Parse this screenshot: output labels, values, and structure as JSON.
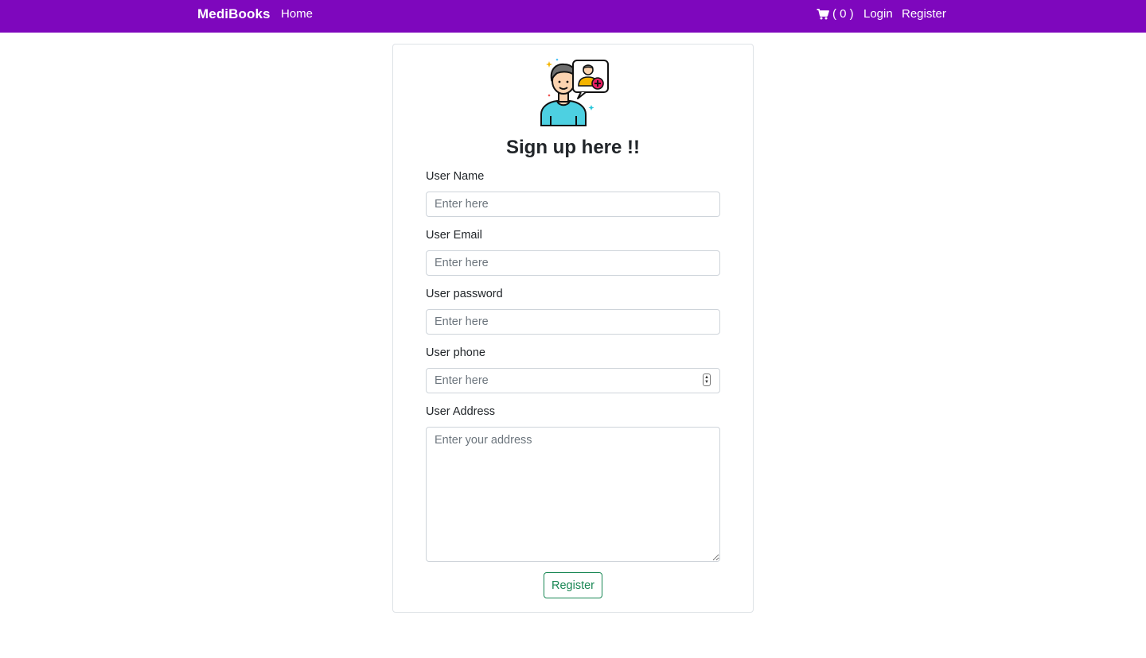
{
  "navbar": {
    "brand": "MediBooks",
    "home_label": "Home",
    "cart_label": "( 0 )",
    "cart_icon": "cart-icon",
    "login_label": "Login",
    "register_label": "Register",
    "background_color": "#7e07bd"
  },
  "form": {
    "avatar_icon": "user-add-avatar-icon",
    "title": "Sign up here !!",
    "fields": [
      {
        "label": "User Name",
        "placeholder": "Enter here",
        "value": ""
      },
      {
        "label": "User Email",
        "placeholder": "Enter here",
        "value": ""
      },
      {
        "label": "User password",
        "placeholder": "Enter here",
        "value": ""
      },
      {
        "label": "User phone",
        "placeholder": "Enter here",
        "value": ""
      },
      {
        "label": "User Address",
        "placeholder": "Enter your address",
        "value": ""
      }
    ],
    "submit_label": "Register",
    "submit_color": "#198754"
  }
}
